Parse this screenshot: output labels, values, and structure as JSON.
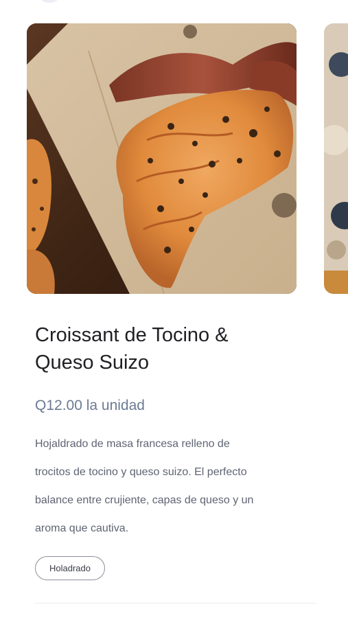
{
  "product": {
    "title_line1": "Croissant de Tocino &",
    "title_line2": "Queso Suizo",
    "price": "Q12.00 la unidad",
    "description_lines": [
      "Hojaldrado de masa francesa relleno de",
      "trocitos de tocino y queso suizo. El perfecto",
      "balance entre crujiente, capas de queso y un",
      "aroma que cautiva."
    ],
    "tag": "Holadrado"
  },
  "carousel": {
    "current_image": "croissant-photo",
    "next_image": "next-product-photo"
  }
}
